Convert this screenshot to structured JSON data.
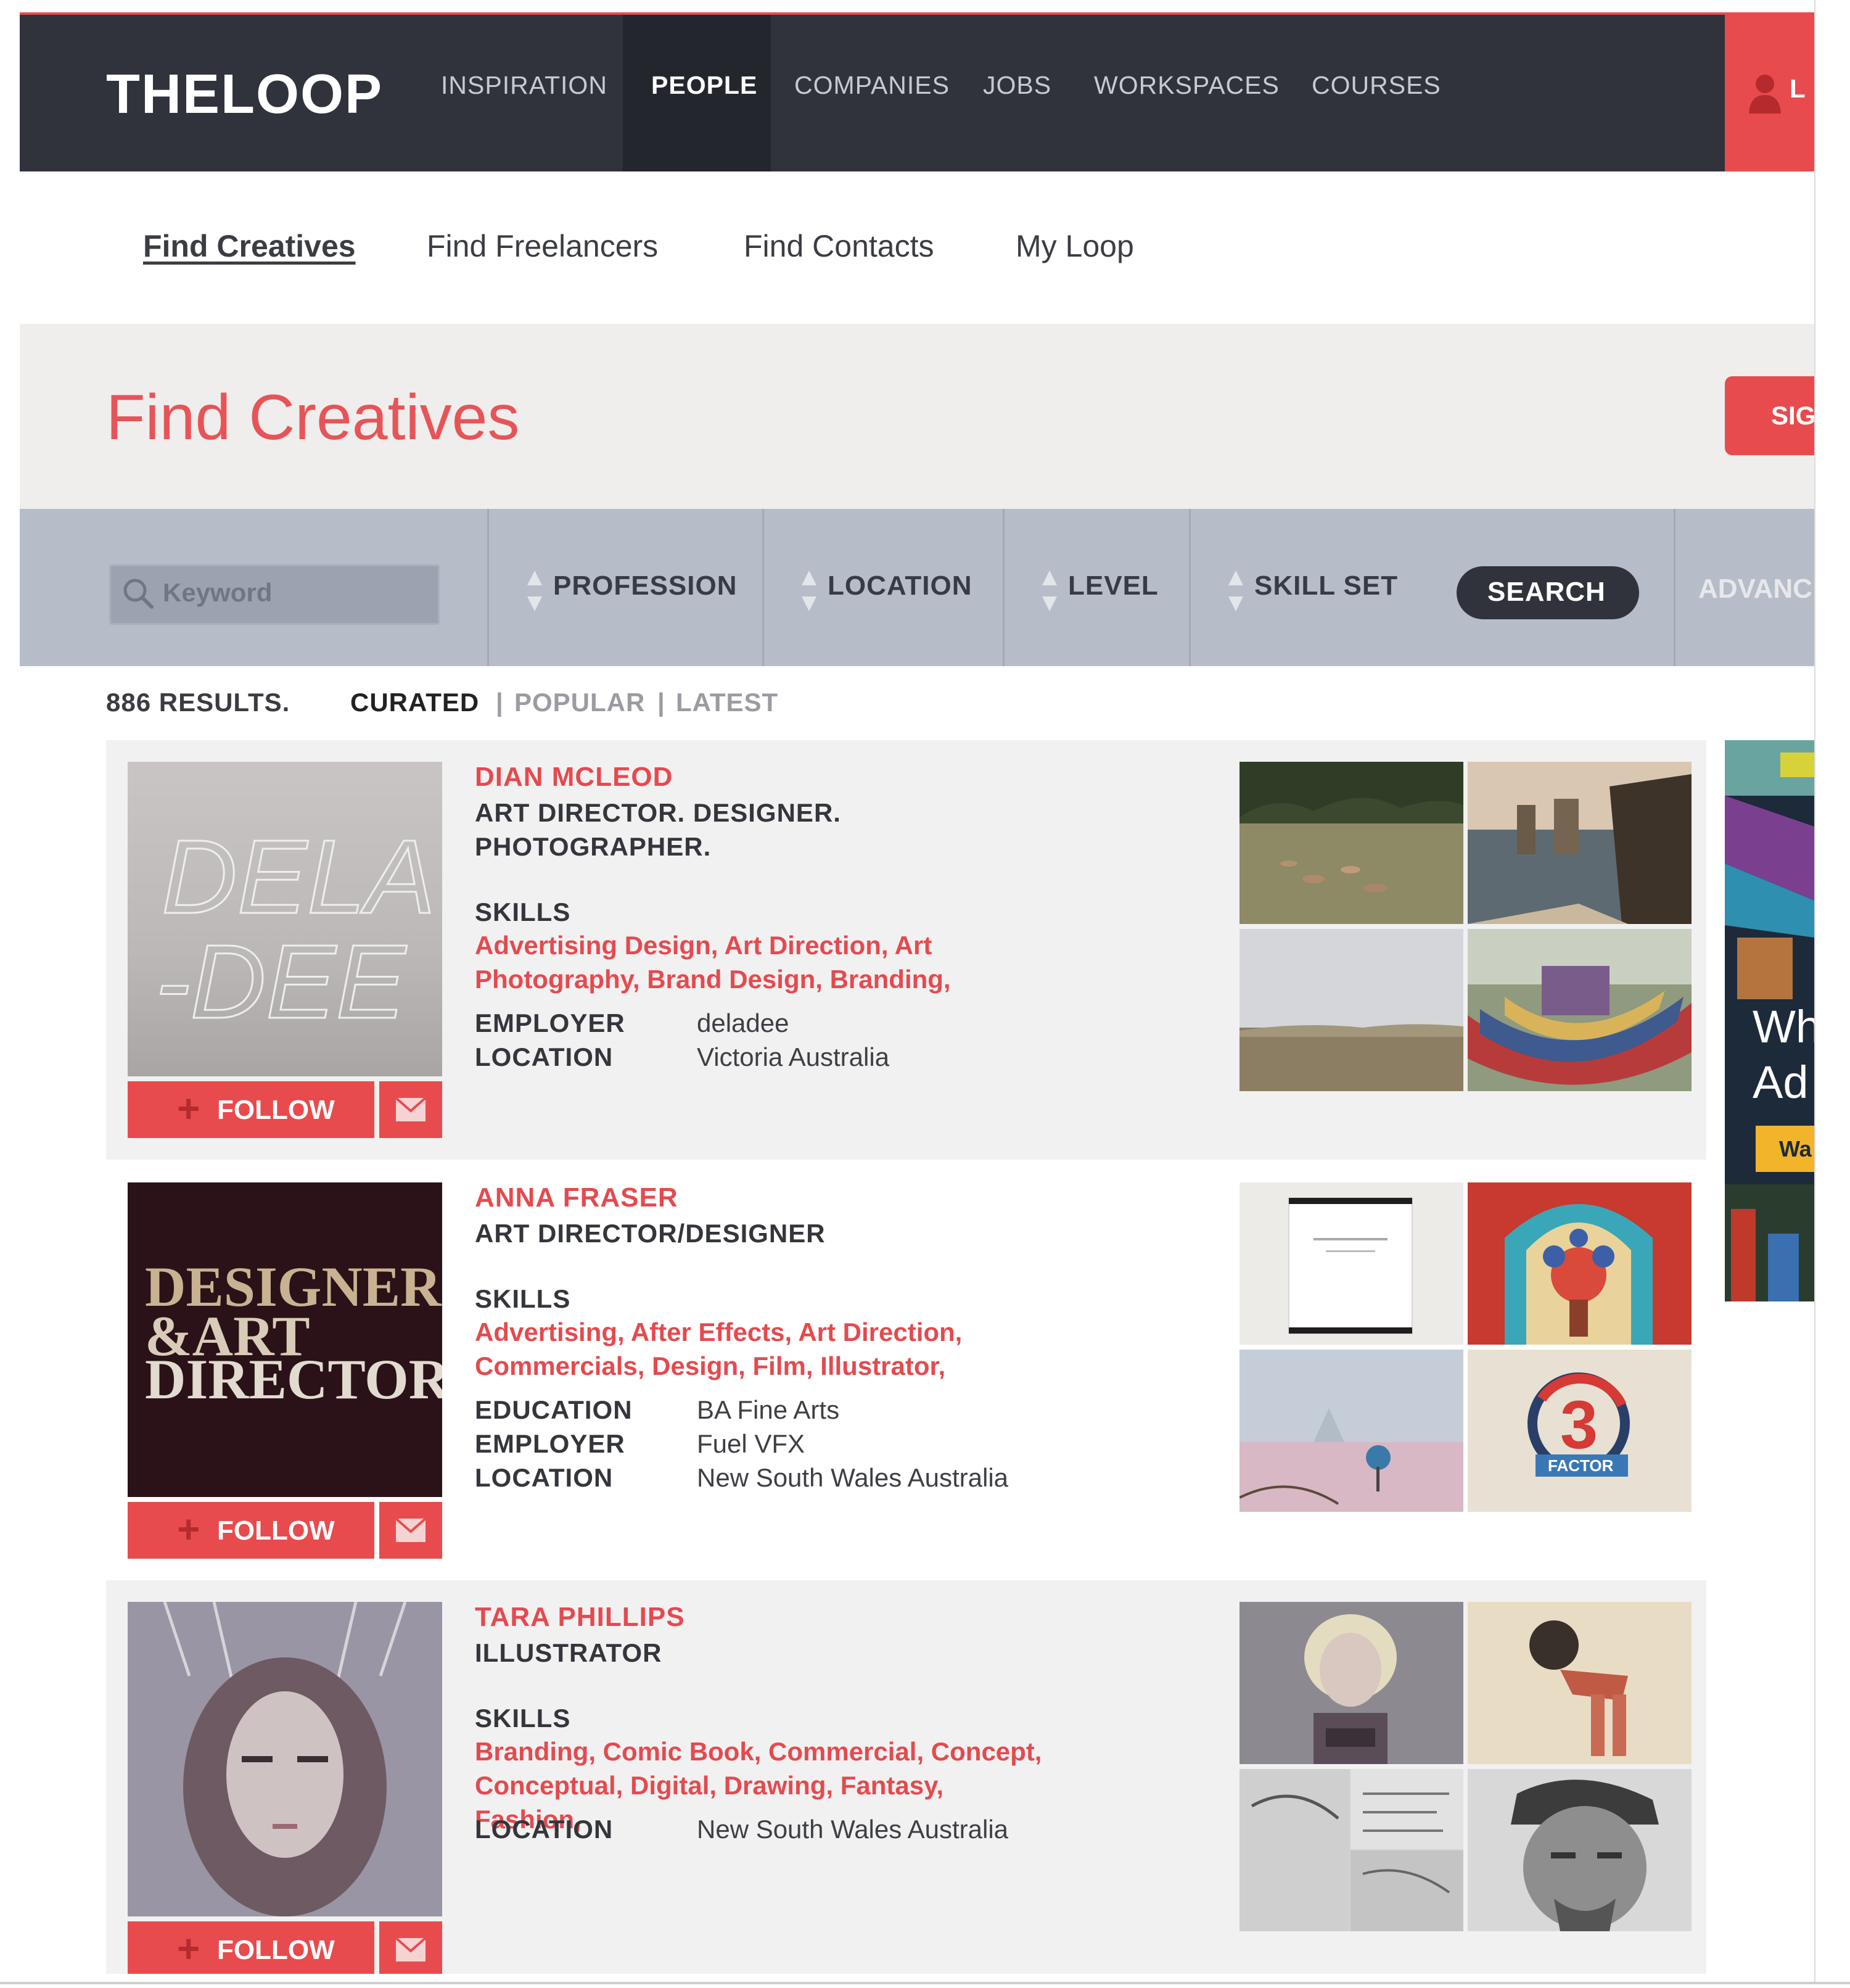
{
  "header": {
    "logo": "THELOOP",
    "nav": [
      "INSPIRATION",
      "PEOPLE",
      "COMPANIES",
      "JOBS",
      "WORKSPACES",
      "COURSES"
    ],
    "login_label": "L"
  },
  "subnav": [
    "Find Creatives",
    "Find Freelancers",
    "Find Contacts",
    "My Loop"
  ],
  "page": {
    "title": "Find Creatives",
    "signup_label": "SIG"
  },
  "search": {
    "placeholder": "Keyword",
    "filters": [
      "PROFESSION",
      "LOCATION",
      "LEVEL",
      "SKILL SET"
    ],
    "search_label": "SEARCH",
    "advanced_label": "ADVANC"
  },
  "results": {
    "count": "886 RESULTS.",
    "sort_curated": "CURATED",
    "sort_sep1": "|",
    "sort_popular": "POPULAR",
    "sort_sep2": "|",
    "sort_latest": "LATEST"
  },
  "people": [
    {
      "name": "DIAN MCLEOD",
      "role_line1": "ART DIRECTOR. DESIGNER.",
      "role_line2": "PHOTOGRAPHER.",
      "skills_heading": "SKILLS",
      "skills_line1": "Advertising Design, Art Direction, Art",
      "skills_line2": "Photography, Brand Design, Branding,",
      "details": [
        {
          "label": "EMPLOYER",
          "value": "deladee"
        },
        {
          "label": "LOCATION",
          "value": "Victoria Australia"
        }
      ],
      "avatar_text1": "DELA",
      "avatar_text2": "-DEE",
      "follow_label": "FOLLOW"
    },
    {
      "name": "ANNA FRASER",
      "role_line1": "ART DIRECTOR/DESIGNER",
      "role_line2": "",
      "skills_heading": "SKILLS",
      "skills_line1": "Advertising, After Effects, Art Direction,",
      "skills_line2": "Commercials, Design, Film, Illustrator,",
      "details": [
        {
          "label": "EDUCATION",
          "value": "BA Fine Arts"
        },
        {
          "label": "EMPLOYER",
          "value": "Fuel VFX"
        },
        {
          "label": "LOCATION",
          "value": "New South Wales Australia"
        }
      ],
      "avatar_text1": "DESIGNER",
      "avatar_text2": "&ART",
      "avatar_text3": "DIRECTOR",
      "follow_label": "FOLLOW"
    },
    {
      "name": "TARA PHILLIPS",
      "role_line1": "ILLUSTRATOR",
      "role_line2": "",
      "skills_heading": "SKILLS",
      "skills_line1": "Branding, Comic Book, Commercial, Concept,",
      "skills_line2": "Conceptual, Digital, Drawing, Fantasy, Fashion,",
      "details": [
        {
          "label": "LOCATION",
          "value": "New South Wales Australia"
        }
      ],
      "follow_label": "FOLLOW"
    }
  ],
  "thumb_text": {
    "factor_number": "3",
    "factor_word": "FACTOR"
  },
  "ad": {
    "line1": "Wh",
    "line2": "Ad",
    "button": "Wa"
  },
  "colors": {
    "accent": "#e84b4d",
    "header_bg": "#30333c",
    "filter_bar": "#b6bdc8"
  },
  "icons": [
    "search-icon",
    "user-icon",
    "plus-icon",
    "mail-icon",
    "sort-arrows-icon"
  ]
}
